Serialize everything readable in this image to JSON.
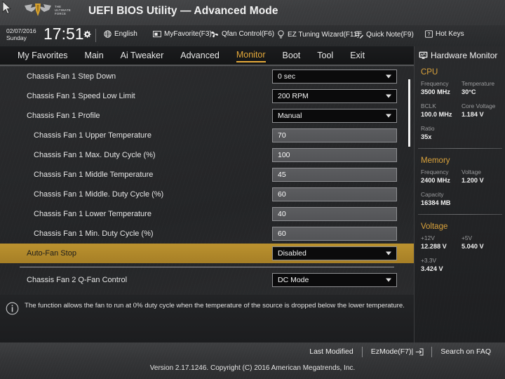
{
  "header": {
    "title": "UEFI BIOS Utility — Advanced Mode",
    "logo_line1": "THE",
    "logo_line2": "ULTIMATE",
    "logo_line3": "FORCE",
    "logo_icon": "tuf-wing-logo",
    "cursor_icon": "mouse-cursor-arrow"
  },
  "toolbar": {
    "date": "02/07/2016",
    "weekday": "Sunday",
    "time": "17:51",
    "gear_icon": "gear-icon",
    "items": [
      {
        "label": "English",
        "icon": "globe-icon"
      },
      {
        "label": "MyFavorite(F3)",
        "icon": "star-window-icon"
      },
      {
        "label": "Qfan Control(F6)",
        "icon": "fan-icon"
      },
      {
        "label": "EZ Tuning Wizard(F11)",
        "icon": "lightbulb-icon"
      },
      {
        "label": "Quick Note(F9)",
        "icon": "note-pencil-icon"
      },
      {
        "label": "Hot Keys",
        "icon": "question-key-icon"
      }
    ]
  },
  "nav": {
    "tabs": [
      {
        "label": "My Favorites",
        "active": false
      },
      {
        "label": "Main",
        "active": false
      },
      {
        "label": "Ai Tweaker",
        "active": false
      },
      {
        "label": "Advanced",
        "active": false
      },
      {
        "label": "Monitor",
        "active": true
      },
      {
        "label": "Boot",
        "active": false
      },
      {
        "label": "Tool",
        "active": false
      },
      {
        "label": "Exit",
        "active": false
      }
    ],
    "active_color": "#e5a93a"
  },
  "settings": {
    "rows": [
      {
        "label": "Chassis Fan 1 Step Down",
        "value": "0 sec",
        "type": "select",
        "indent": false,
        "highlight": false
      },
      {
        "label": "Chassis Fan 1 Speed Low Limit",
        "value": "200 RPM",
        "type": "select",
        "indent": false,
        "highlight": false
      },
      {
        "label": "Chassis Fan 1 Profile",
        "value": "Manual",
        "type": "select",
        "indent": false,
        "highlight": false
      },
      {
        "label": "Chassis Fan 1 Upper Temperature",
        "value": "70",
        "type": "input",
        "indent": true,
        "highlight": false
      },
      {
        "label": "Chassis Fan 1 Max. Duty Cycle (%)",
        "value": "100",
        "type": "input",
        "indent": true,
        "highlight": false
      },
      {
        "label": "Chassis Fan 1 Middle Temperature",
        "value": "45",
        "type": "input",
        "indent": true,
        "highlight": false
      },
      {
        "label": "Chassis Fan 1 Middle. Duty Cycle (%)",
        "value": "60",
        "type": "input",
        "indent": true,
        "highlight": false
      },
      {
        "label": "Chassis Fan 1 Lower Temperature",
        "value": "40",
        "type": "input",
        "indent": true,
        "highlight": false
      },
      {
        "label": "Chassis Fan 1 Min. Duty Cycle (%)",
        "value": "60",
        "type": "input",
        "indent": true,
        "highlight": false
      },
      {
        "label": "Auto-Fan Stop",
        "value": "Disabled",
        "type": "select",
        "indent": true,
        "highlight": true
      },
      {
        "label": "__SEPARATOR__",
        "value": "",
        "type": "sep",
        "indent": false,
        "highlight": false
      },
      {
        "label": "Chassis Fan 2 Q-Fan Control",
        "value": "DC Mode",
        "type": "select",
        "indent": false,
        "highlight": false
      }
    ],
    "highlight_color": "#bb922f",
    "scrollbar": {
      "thumb_color": "#f3f3f3"
    }
  },
  "help": {
    "icon": "info-icon",
    "text": "The function allows the fan to run at 0% duty cycle when the temperature of the source is dropped below the lower temperature."
  },
  "sidebar": {
    "title": "Hardware Monitor",
    "title_icon": "monitor-icon",
    "accent_color": "#d9a23c",
    "sections": [
      {
        "name": "CPU",
        "pairs": [
          [
            {
              "key": "Frequency",
              "value": "3500 MHz"
            },
            {
              "key": "Temperature",
              "value": "30°C"
            }
          ],
          [
            {
              "key": "BCLK",
              "value": "100.0 MHz"
            },
            {
              "key": "Core Voltage",
              "value": "1.184 V"
            }
          ],
          [
            {
              "key": "Ratio",
              "value": "35x"
            }
          ]
        ]
      },
      {
        "name": "Memory",
        "pairs": [
          [
            {
              "key": "Frequency",
              "value": "2400 MHz"
            },
            {
              "key": "Voltage",
              "value": "1.200 V"
            }
          ],
          [
            {
              "key": "Capacity",
              "value": "16384 MB"
            }
          ]
        ]
      },
      {
        "name": "Voltage",
        "pairs": [
          [
            {
              "key": "+12V",
              "value": "12.288 V"
            },
            {
              "key": "+5V",
              "value": "5.040 V"
            }
          ],
          [
            {
              "key": "+3.3V",
              "value": "3.424 V"
            }
          ]
        ]
      }
    ]
  },
  "footer": {
    "buttons": [
      {
        "label": "Last Modified",
        "icon": ""
      },
      {
        "label": "EzMode(F7)|",
        "icon": "arrow-into-box-icon"
      },
      {
        "label": "Search on FAQ",
        "icon": ""
      }
    ],
    "version": "Version 2.17.1246. Copyright (C) 2016 American Megatrends, Inc."
  }
}
